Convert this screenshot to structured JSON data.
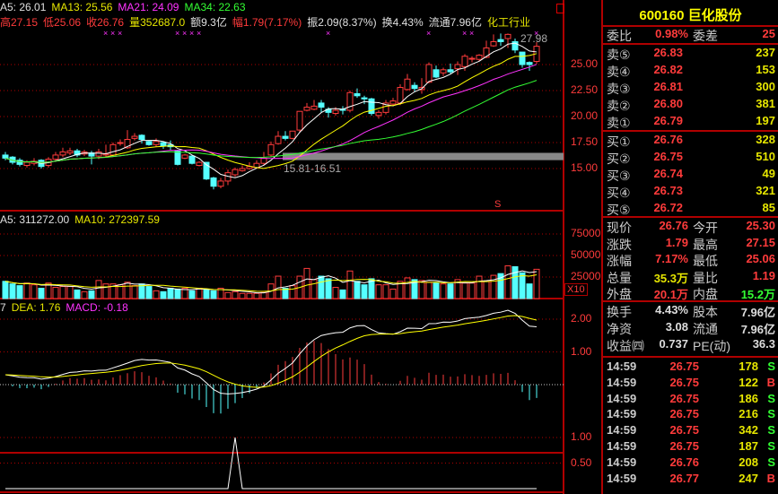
{
  "header": {
    "ma_line": [
      {
        "t": "A5: 26.01",
        "c": "#e0e0e0"
      },
      {
        "t": "MA13: 25.56",
        "c": "#e6e600"
      },
      {
        "t": "MA21: 24.09",
        "c": "#ff33ff"
      },
      {
        "t": "MA34: 22.63",
        "c": "#33ff33"
      }
    ],
    "info_line": [
      {
        "t": "高27.15",
        "c": "#ff3b3b"
      },
      {
        "t": "低25.06",
        "c": "#ff3b3b"
      },
      {
        "t": "收26.76",
        "c": "#ff3b3b"
      },
      {
        "t": "量352687.0",
        "c": "#e6e600"
      },
      {
        "t": "额9.3亿",
        "c": "#e0e0e0"
      },
      {
        "t": "幅1.79(7.17%)",
        "c": "#ff3b3b"
      },
      {
        "t": "振2.09(8.37%)",
        "c": "#e0e0e0"
      },
      {
        "t": "换4.43%",
        "c": "#e0e0e0"
      },
      {
        "t": "流通7.96亿",
        "c": "#e0e0e0"
      },
      {
        "t": "化工行业",
        "c": "#e6e600"
      }
    ]
  },
  "price_panel": {
    "axis_labels": [
      "25.00",
      "22.50",
      "20.00",
      "17.50",
      "15.00"
    ],
    "axis_values": [
      25,
      22.5,
      20,
      17.5,
      15
    ],
    "high_marker": "27.98",
    "band_label": "15.81-16.51",
    "band": [
      15.81,
      16.51
    ],
    "signal_marker": "S",
    "x_marker_indices": [
      14,
      15,
      16,
      24,
      25,
      26,
      27,
      45,
      59,
      64,
      65,
      74
    ]
  },
  "volume_panel": {
    "legend": [
      {
        "t": "A5: 311272.00",
        "c": "#e0e0e0"
      },
      {
        "t": "MA10: 272397.59",
        "c": "#e6e600"
      }
    ],
    "axis_labels": [
      "75000",
      "50000",
      "25000"
    ],
    "axis_values": [
      75000,
      50000,
      25000
    ],
    "unit": "X10"
  },
  "macd_panel": {
    "legend": [
      {
        "t": "7",
        "c": "#e0e0e0"
      },
      {
        "t": "DEA: 1.76",
        "c": "#e6e600"
      },
      {
        "t": "MACD: -0.18",
        "c": "#ff33ff"
      }
    ],
    "axis_labels": [
      "2.00",
      "1.00"
    ],
    "axis_values": [
      2,
      1
    ]
  },
  "signal_panel": {
    "axis_labels": [
      "1.00",
      "0.50"
    ],
    "axis_values": [
      1,
      0.5
    ],
    "values_spike_index": 32
  },
  "chart_data": {
    "type": "candlestick",
    "ohlc": [
      [
        16.3,
        16.0,
        16.6,
        15.8
      ],
      [
        16.1,
        15.6,
        16.2,
        15.4
      ],
      [
        15.8,
        15.4,
        16.0,
        15.2
      ],
      [
        15.3,
        15.6,
        15.8,
        15.1
      ],
      [
        15.5,
        15.7,
        16.0,
        15.3
      ],
      [
        15.8,
        15.2,
        15.9,
        15.0
      ],
      [
        15.3,
        15.9,
        16.1,
        15.1
      ],
      [
        15.9,
        16.3,
        16.6,
        15.7
      ],
      [
        16.3,
        16.6,
        17.0,
        16.1
      ],
      [
        16.5,
        16.7,
        17.0,
        16.3
      ],
      [
        16.7,
        16.3,
        16.9,
        16.1
      ],
      [
        16.4,
        16.6,
        16.8,
        16.2
      ],
      [
        16.5,
        16.2,
        16.7,
        15.4
      ],
      [
        16.2,
        16.6,
        16.9,
        15.9
      ],
      [
        16.3,
        16.4,
        17.3,
        16.1
      ],
      [
        16.3,
        17.3,
        17.5,
        16.2
      ],
      [
        17.5,
        17.5,
        17.8,
        17.2
      ],
      [
        17.0,
        17.8,
        18.7,
        16.9
      ],
      [
        17.9,
        18.1,
        18.4,
        17.7
      ],
      [
        18.2,
        17.8,
        18.3,
        17.4
      ],
      [
        17.6,
        17.3,
        17.7,
        17.2
      ],
      [
        17.3,
        17.6,
        17.9,
        17.1
      ],
      [
        17.5,
        17.2,
        17.6,
        16.9
      ],
      [
        17.3,
        17.1,
        17.7,
        16.8
      ],
      [
        16.7,
        15.4,
        16.8,
        15.3
      ],
      [
        16.0,
        16.3,
        16.4,
        15.9
      ],
      [
        16.2,
        15.5,
        16.3,
        15.4
      ],
      [
        15.3,
        15.6,
        15.7,
        15.2
      ],
      [
        15.6,
        14.0,
        15.6,
        13.9
      ],
      [
        14.1,
        13.3,
        14.2,
        13.0
      ],
      [
        13.3,
        13.8,
        14.1,
        13.1
      ],
      [
        13.8,
        14.6,
        14.9,
        13.4
      ],
      [
        14.4,
        14.9,
        15.1,
        14.2
      ],
      [
        14.8,
        15.0,
        15.3,
        14.7
      ],
      [
        15.0,
        15.2,
        15.6,
        14.9
      ],
      [
        15.1,
        15.5,
        15.8,
        15.0
      ],
      [
        15.5,
        16.0,
        16.6,
        15.3
      ],
      [
        16.3,
        17.3,
        17.6,
        16.1
      ],
      [
        17.4,
        18.1,
        18.6,
        17.3
      ],
      [
        18.1,
        17.9,
        18.6,
        17.7
      ],
      [
        17.9,
        18.6,
        18.6,
        17.8
      ],
      [
        18.7,
        20.5,
        20.5,
        18.5
      ],
      [
        20.6,
        20.9,
        21.3,
        20.5
      ],
      [
        20.7,
        21.0,
        21.6,
        20.6
      ],
      [
        21.3,
        20.9,
        21.6,
        20.4
      ],
      [
        20.7,
        20.4,
        20.9,
        19.9
      ],
      [
        20.3,
        20.6,
        20.9,
        20.1
      ],
      [
        20.7,
        20.6,
        21.0,
        20.2
      ],
      [
        20.6,
        22.3,
        22.5,
        20.4
      ],
      [
        22.2,
        22.0,
        22.7,
        21.8
      ],
      [
        21.8,
        21.7,
        22.0,
        21.2
      ],
      [
        21.7,
        20.3,
        21.8,
        20.1
      ],
      [
        20.1,
        20.4,
        20.6,
        19.8
      ],
      [
        20.4,
        21.3,
        21.6,
        20.2
      ],
      [
        21.2,
        21.5,
        21.8,
        21.0
      ],
      [
        21.3,
        22.8,
        23.1,
        21.1
      ],
      [
        22.6,
        23.6,
        24.1,
        22.5
      ],
      [
        23.0,
        22.7,
        23.3,
        22.4
      ],
      [
        22.6,
        22.8,
        23.7,
        22.2
      ],
      [
        23.3,
        25.0,
        25.2,
        23.2
      ],
      [
        24.5,
        23.8,
        24.9,
        23.7
      ],
      [
        24.2,
        24.5,
        24.7,
        23.9
      ],
      [
        24.5,
        24.3,
        25.1,
        24.1
      ],
      [
        24.6,
        25.0,
        25.3,
        24.0
      ],
      [
        24.8,
        25.8,
        26.0,
        24.4
      ],
      [
        25.6,
        25.6,
        25.8,
        25.2
      ],
      [
        25.5,
        25.9,
        26.0,
        25.3
      ],
      [
        25.7,
        26.6,
        27.3,
        25.6
      ],
      [
        26.8,
        27.2,
        27.9,
        26.7
      ],
      [
        27.4,
        27.2,
        27.98,
        26.8
      ],
      [
        27.5,
        27.9,
        27.98,
        26.6
      ],
      [
        27.2,
        26.4,
        27.5,
        26.1
      ],
      [
        26.2,
        25.0,
        26.2,
        24.7
      ],
      [
        25.2,
        25.0,
        25.3,
        24.4
      ],
      [
        25.3,
        26.76,
        27.15,
        25.06
      ]
    ],
    "volume": [
      20000,
      17000,
      15000,
      18000,
      16000,
      12000,
      18000,
      13000,
      14000,
      14000,
      10000,
      8000,
      9000,
      21000,
      17000,
      17000,
      16000,
      19000,
      15000,
      17000,
      14000,
      9000,
      8000,
      12000,
      11000,
      12000,
      9000,
      12000,
      10000,
      9000,
      12000,
      7000,
      8000,
      6000,
      6000,
      6000,
      7000,
      17000,
      26000,
      12000,
      15000,
      26000,
      35000,
      22000,
      26000,
      23000,
      13000,
      10000,
      32000,
      20000,
      16000,
      23000,
      16000,
      16000,
      11000,
      20000,
      24000,
      22000,
      21000,
      19000,
      18000,
      17000,
      17000,
      22000,
      18000,
      18000,
      26000,
      20000,
      27000,
      29000,
      38000,
      37000,
      30000,
      17000,
      34000
    ]
  },
  "quote": {
    "code": "600160",
    "name": "巨化股份",
    "weibi_label": "委比",
    "weibi": "0.98%",
    "weicha_label": "委差",
    "weicha": "25",
    "sell": [
      {
        "l": "卖⑤",
        "p": "26.83",
        "v": "237"
      },
      {
        "l": "卖④",
        "p": "26.82",
        "v": "153"
      },
      {
        "l": "卖③",
        "p": "26.81",
        "v": "300"
      },
      {
        "l": "卖②",
        "p": "26.80",
        "v": "381"
      },
      {
        "l": "卖①",
        "p": "26.79",
        "v": "197"
      }
    ],
    "buy": [
      {
        "l": "买①",
        "p": "26.76",
        "v": "328"
      },
      {
        "l": "买②",
        "p": "26.75",
        "v": "510"
      },
      {
        "l": "买③",
        "p": "26.74",
        "v": "49"
      },
      {
        "l": "买④",
        "p": "26.73",
        "v": "321"
      },
      {
        "l": "买⑤",
        "p": "26.72",
        "v": "85"
      }
    ],
    "stats": [
      {
        "l1": "现价",
        "v1": "26.76",
        "c1": "#ff3b3b",
        "l2": "今开",
        "v2": "25.30",
        "c2": "#ff3b3b"
      },
      {
        "l1": "涨跌",
        "v1": "1.79",
        "c1": "#ff3b3b",
        "l2": "最高",
        "v2": "27.15",
        "c2": "#ff3b3b"
      },
      {
        "l1": "涨幅",
        "v1": "7.17%",
        "c1": "#ff3b3b",
        "l2": "最低",
        "v2": "25.06",
        "c2": "#ff3b3b"
      },
      {
        "l1": "总量",
        "v1": "35.3万",
        "c1": "#e6e600",
        "l2": "量比",
        "v2": "1.19",
        "c2": "#ff3b3b"
      },
      {
        "l1": "外盘",
        "v1": "20.1万",
        "c1": "#ff3b3b",
        "l2": "内盘",
        "v2": "15.2万",
        "c2": "#33ff33"
      }
    ],
    "stats2": [
      {
        "l1": "换手",
        "v1": "4.43%",
        "l2": "股本",
        "v2": "7.96亿"
      },
      {
        "l1": "净资",
        "v1": "3.08",
        "l2": "流通",
        "v2": "7.96亿"
      },
      {
        "l1": "收益㈣",
        "v1": "0.737",
        "l2": "PE(动)",
        "v2": "36.3"
      }
    ],
    "trades": [
      {
        "t": "14:59",
        "p": "26.75",
        "v": "178",
        "s": "S"
      },
      {
        "t": "14:59",
        "p": "26.75",
        "v": "122",
        "s": "B"
      },
      {
        "t": "14:59",
        "p": "26.75",
        "v": "186",
        "s": "S"
      },
      {
        "t": "14:59",
        "p": "26.75",
        "v": "216",
        "s": "S"
      },
      {
        "t": "14:59",
        "p": "26.75",
        "v": "342",
        "s": "S"
      },
      {
        "t": "14:59",
        "p": "26.75",
        "v": "187",
        "s": "S"
      },
      {
        "t": "14:59",
        "p": "26.76",
        "v": "208",
        "s": "S"
      },
      {
        "t": "14:59",
        "p": "26.77",
        "v": "247",
        "s": "B"
      }
    ]
  },
  "colors": {
    "up": "#ff3b3b",
    "down": "#55ffff",
    "grid": "#b00000",
    "ma5": "#ffffff",
    "ma13": "#ffff00",
    "ma21": "#ff33ff",
    "ma34": "#33ff33"
  }
}
